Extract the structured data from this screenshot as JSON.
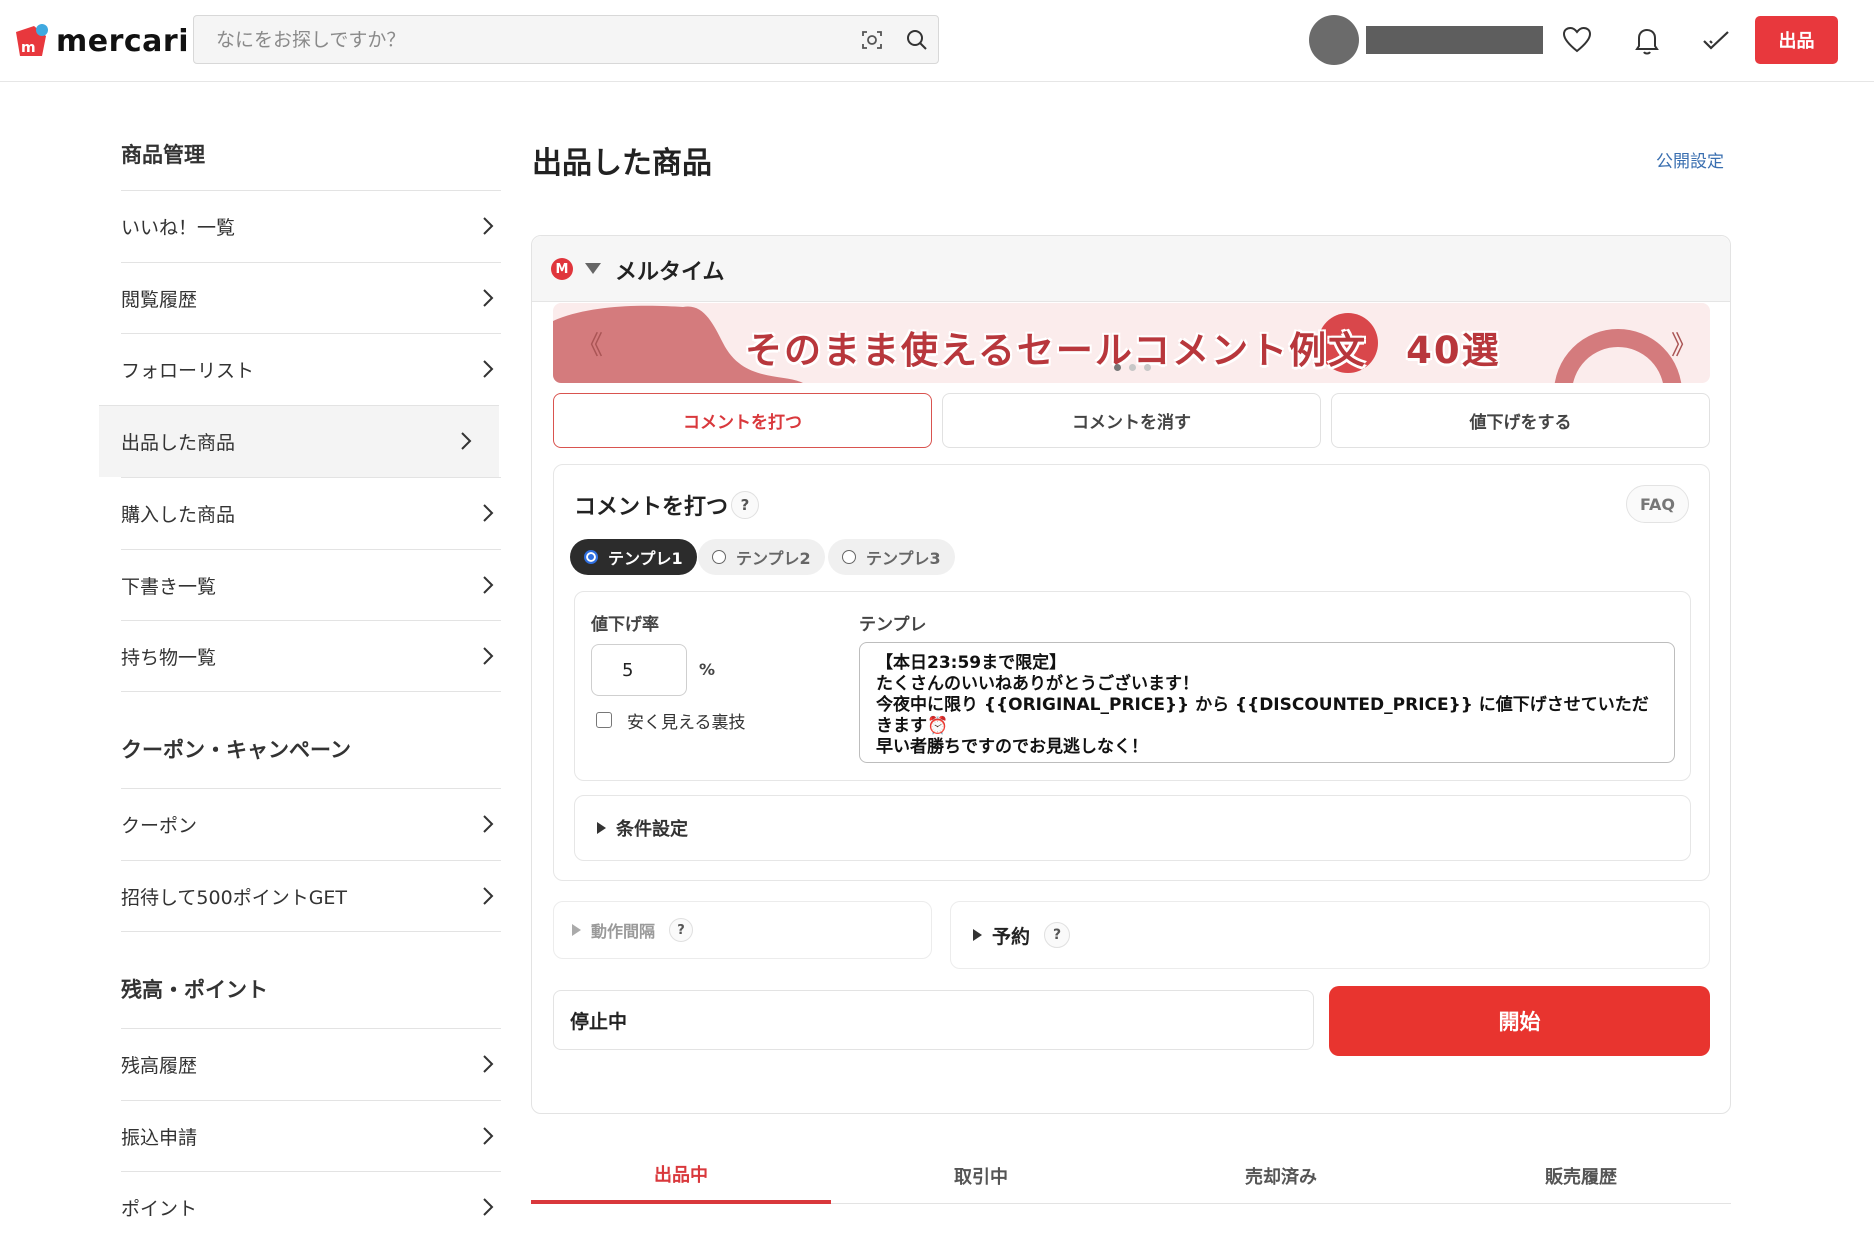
{
  "header": {
    "logo_text": "mercari",
    "search_placeholder": "なにをお探しですか？",
    "sell_label": "出品"
  },
  "sidebar": {
    "sections": [
      {
        "title": "商品管理"
      },
      {
        "title": "クーポン・キャンペーン"
      },
      {
        "title": "残高・ポイント"
      }
    ],
    "items": [
      {
        "label": "いいね！一覧"
      },
      {
        "label": "閲覧履歴"
      },
      {
        "label": "フォローリスト"
      },
      {
        "label": "出品した商品"
      },
      {
        "label": "購入した商品"
      },
      {
        "label": "下書き一覧"
      },
      {
        "label": "持ち物一覧"
      },
      {
        "label": "クーポン"
      },
      {
        "label": "招待して500ポイントGET"
      },
      {
        "label": "残高履歴"
      },
      {
        "label": "振込申請"
      },
      {
        "label": "ポイント"
      }
    ],
    "active_item": "出品した商品"
  },
  "main": {
    "title": "出品した商品",
    "public_settings_link": "公開設定",
    "panel": {
      "title": "メルタイム",
      "logo_letter": "M",
      "banner_text": "そのまま使えるセールコメント例文　40選",
      "banner_prev": "《",
      "banner_next": "》",
      "action_tabs": [
        {
          "label": "コメントを打つ"
        },
        {
          "label": "コメントを消す"
        },
        {
          "label": "値下げをする"
        }
      ],
      "active_tab": "コメントを打つ",
      "card": {
        "title": "コメントを打つ",
        "help": "?",
        "faq": "FAQ",
        "templates": [
          {
            "label": "テンプレ1"
          },
          {
            "label": "テンプレ2"
          },
          {
            "label": "テンプレ3"
          }
        ],
        "selected_template": "テンプレ1",
        "rate_label": "値下げ率",
        "rate_value": "5",
        "rate_unit": "%",
        "cheap_trick_label": "安く見える裏技",
        "template_label": "テンプレ",
        "template_text": "【本日23:59まで限定】\nたくさんのいいねありがとうございます！\n今夜中に限り {{ORIGINAL_PRICE}} から {{DISCOUNTED_PRICE}} に値下げさせていただきます⏰\n早い者勝ちですのでお見逃しなく！",
        "conditions_label": "条件設定"
      },
      "interval_label": "動作間隔",
      "reserve_label": "予約",
      "status_text": "停止中",
      "start_label": "開始"
    },
    "bottom_tabs": [
      {
        "label": "出品中"
      },
      {
        "label": "取引中"
      },
      {
        "label": "売却済み"
      },
      {
        "label": "販売履歴"
      }
    ],
    "active_bottom_tab": "出品中"
  },
  "colors": {
    "brand_red": "#e8383d",
    "link_blue": "#3a6fb0",
    "radio_blue": "#2f6fe0"
  }
}
